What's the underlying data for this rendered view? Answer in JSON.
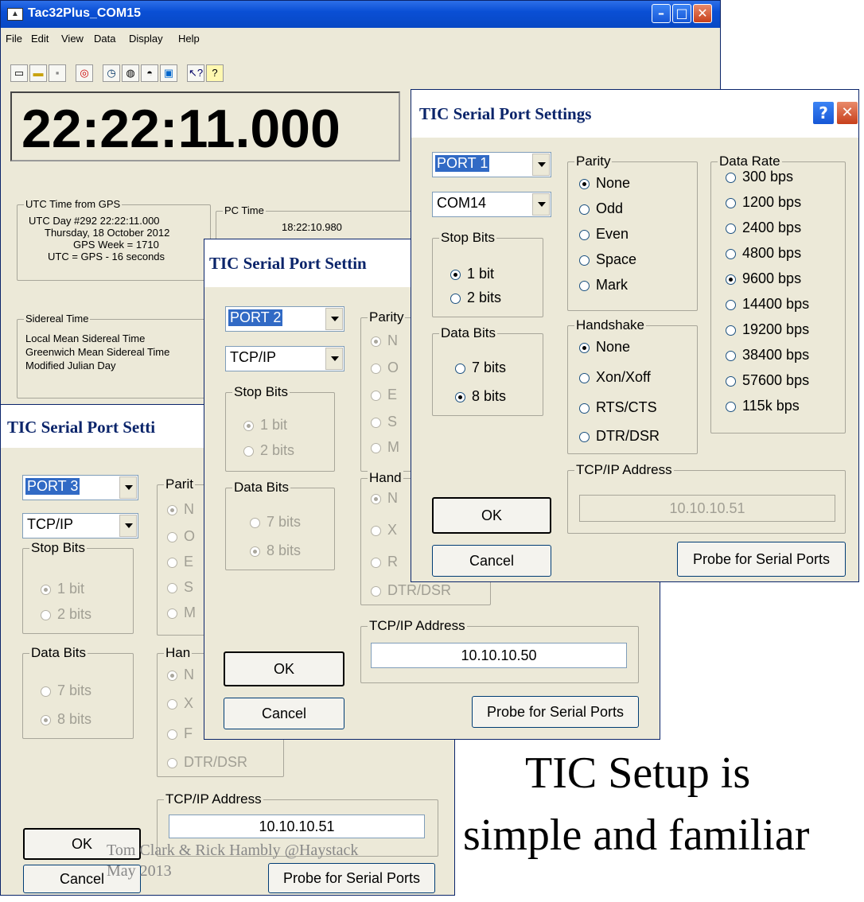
{
  "main_window": {
    "title": "Tac32Plus_COM15",
    "menu": [
      "File",
      "Edit",
      "View",
      "Data",
      "Display",
      "Help"
    ],
    "clock": "22:22:11.000",
    "utc_group": {
      "label": "UTC Time from GPS",
      "lines": [
        "UTC Day #292  22:22:11.000",
        "Thursday, 18 October 2012",
        "GPS Week = 1710",
        "UTC = GPS - 16 seconds"
      ]
    },
    "pc_group": {
      "label": "PC Time",
      "time": "18:22:10.980"
    },
    "sidereal_group": {
      "label": "Sidereal Time",
      "lines": [
        "Local Mean Sidereal Time",
        "Greenwich Mean Sidereal Time",
        "Modified Julian Day"
      ]
    }
  },
  "dialog_port1": {
    "title": "TIC Serial Port Settings",
    "port": "PORT 1",
    "com": "COM14",
    "stop_bits": {
      "label": "Stop Bits",
      "options": [
        "1 bit",
        "2 bits"
      ],
      "selected": 0
    },
    "data_bits": {
      "label": "Data Bits",
      "options": [
        "7 bits",
        "8 bits"
      ],
      "selected": 1
    },
    "parity": {
      "label": "Parity",
      "options": [
        "None",
        "Odd",
        "Even",
        "Space",
        "Mark"
      ],
      "selected": 0
    },
    "handshake": {
      "label": "Handshake",
      "options": [
        "None",
        "Xon/Xoff",
        "RTS/CTS",
        "DTR/DSR"
      ],
      "selected": 0
    },
    "data_rate": {
      "label": "Data Rate",
      "options": [
        "300 bps",
        "1200 bps",
        "2400 bps",
        "4800 bps",
        "9600 bps",
        "14400 bps",
        "19200 bps",
        "38400 bps",
        "57600 bps",
        "115k bps"
      ],
      "selected": 4
    },
    "tcpip": {
      "label": "TCP/IP Address",
      "value": "10.10.10.51"
    },
    "ok": "OK",
    "cancel": "Cancel",
    "probe": "Probe for Serial Ports"
  },
  "dialog_port2": {
    "title": "TIC Serial Port Settin",
    "port": "PORT 2",
    "com": "TCP/IP",
    "stop_bits": {
      "label": "Stop Bits",
      "options": [
        "1 bit",
        "2 bits"
      ],
      "selected": 0
    },
    "data_bits": {
      "label": "Data Bits",
      "options": [
        "7 bits",
        "8 bits"
      ],
      "selected": 1
    },
    "parity_label": "Parity",
    "parity_partial": [
      "N",
      "O",
      "E",
      "S",
      "M"
    ],
    "handshake_label": "Hand",
    "handshake_partial": [
      "N",
      "X",
      "R",
      "DTR/DSR"
    ],
    "tcpip": {
      "label": "TCP/IP Address",
      "value": "10.10.10.50"
    },
    "ok": "OK",
    "cancel": "Cancel",
    "probe": "Probe for Serial Ports"
  },
  "dialog_port3": {
    "title": "TIC Serial Port Setti",
    "port": "PORT 3",
    "com": "TCP/IP",
    "stop_bits": {
      "label": "Stop Bits",
      "options": [
        "1 bit",
        "2 bits"
      ],
      "selected": 0
    },
    "data_bits": {
      "label": "Data Bits",
      "options": [
        "7 bits",
        "8 bits"
      ],
      "selected": 1
    },
    "parity_label": "Parit",
    "parity_partial": [
      "N",
      "O",
      "E",
      "S",
      "M"
    ],
    "handshake_label": "Han",
    "handshake_partial": [
      "N",
      "X",
      "F",
      "DTR/DSR"
    ],
    "tcpip": {
      "label": "TCP/IP Address",
      "value": "10.10.10.51"
    },
    "ok": "OK",
    "cancel": "Cancel",
    "probe": "Probe for Serial Ports"
  },
  "caption": {
    "line1": "TIC Setup is",
    "line2": "simple and familiar"
  },
  "footer": {
    "line1": "Tom Clark & Rick Hambly @Haystack",
    "line2": "May 2013"
  },
  "colors": {
    "title_blue": "#0a4fd5",
    "dialog_bg": "#ece9d8",
    "selection": "#316ac5"
  }
}
